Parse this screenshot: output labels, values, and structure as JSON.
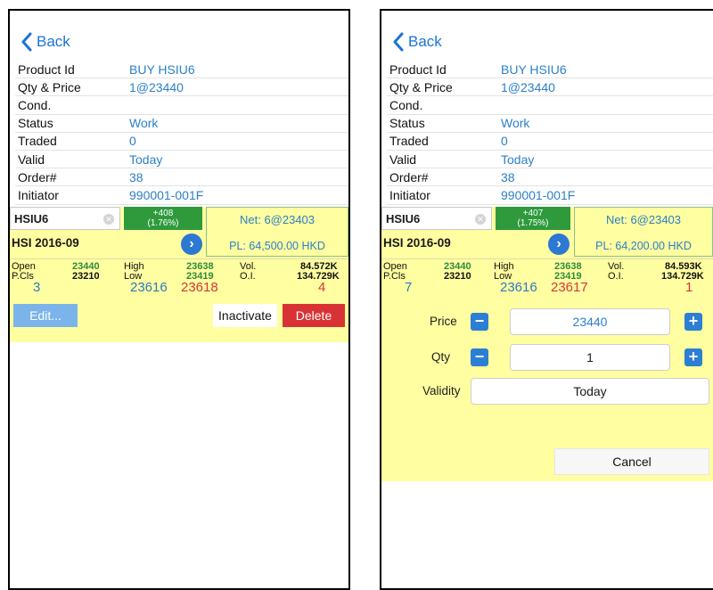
{
  "back_label": "Back",
  "colors": {
    "accent": "#2c80c8",
    "up": "#2e9a3c",
    "ask": "#d9363e",
    "delete": "#d93234",
    "edit": "#7ab4ea",
    "panel": "#fffea0"
  },
  "icons": {
    "back": "chevron-left-icon",
    "go": "chevron-right-circle-icon",
    "clear": "clear-icon",
    "minus": "minus-icon",
    "plus": "plus-icon"
  },
  "left": {
    "order_info": [
      {
        "label": "Product Id",
        "value": "BUY HSIU6"
      },
      {
        "label": "Qty & Price",
        "value": "1@23440"
      },
      {
        "label": "Cond.",
        "value": ""
      },
      {
        "label": "Status",
        "value": "Work"
      },
      {
        "label": "Traded",
        "value": "0"
      },
      {
        "label": "Valid",
        "value": "Today"
      },
      {
        "label": "Order#",
        "value": "38"
      },
      {
        "label": "Initiator",
        "value": "990001-001F"
      }
    ],
    "quote": {
      "product": "HSIU6",
      "change": "+408",
      "change_pct": "(1.76%)",
      "net": "Net: 6@23403",
      "contract": "HSI 2016-09",
      "pl": "PL: 64,500.00 HKD",
      "open_label": "Open",
      "open": "23440",
      "pcls_label": "P.Cls",
      "pcls": "23210",
      "high_label": "High",
      "high": "23638",
      "low_label": "Low",
      "low": "23419",
      "vol_label": "Vol.",
      "vol": "84.572K",
      "oi_label": "O.I.",
      "oi": "134.729K",
      "bid_qty": "3",
      "bid": "23616",
      "ask": "23618",
      "ask_qty": "4"
    },
    "actions": {
      "edit": "Edit...",
      "inactivate": "Inactivate",
      "delete": "Delete"
    }
  },
  "right": {
    "order_info": [
      {
        "label": "Product Id",
        "value": "BUY HSIU6"
      },
      {
        "label": "Qty & Price",
        "value": "1@23440"
      },
      {
        "label": "Cond.",
        "value": ""
      },
      {
        "label": "Status",
        "value": "Work"
      },
      {
        "label": "Traded",
        "value": "0"
      },
      {
        "label": "Valid",
        "value": "Today"
      },
      {
        "label": "Order#",
        "value": "38"
      },
      {
        "label": "Initiator",
        "value": "990001-001F"
      }
    ],
    "quote": {
      "product": "HSIU6",
      "change": "+407",
      "change_pct": "(1.75%)",
      "net": "Net: 6@23403",
      "contract": "HSI 2016-09",
      "pl": "PL: 64,200.00 HKD",
      "open_label": "Open",
      "open": "23440",
      "pcls_label": "P.Cls",
      "pcls": "23210",
      "high_label": "High",
      "high": "23638",
      "low_label": "Low",
      "low": "23419",
      "vol_label": "Vol.",
      "vol": "84.593K",
      "oi_label": "O.I.",
      "oi": "134.729K",
      "bid_qty": "7",
      "bid": "23616",
      "ask": "23617",
      "ask_qty": "1"
    },
    "form": {
      "price_label": "Price",
      "price": "23440",
      "qty_label": "Qty",
      "qty": "1",
      "validity_label": "Validity",
      "validity": "Today",
      "cancel": "Cancel",
      "minus": "−",
      "plus": "+"
    }
  }
}
